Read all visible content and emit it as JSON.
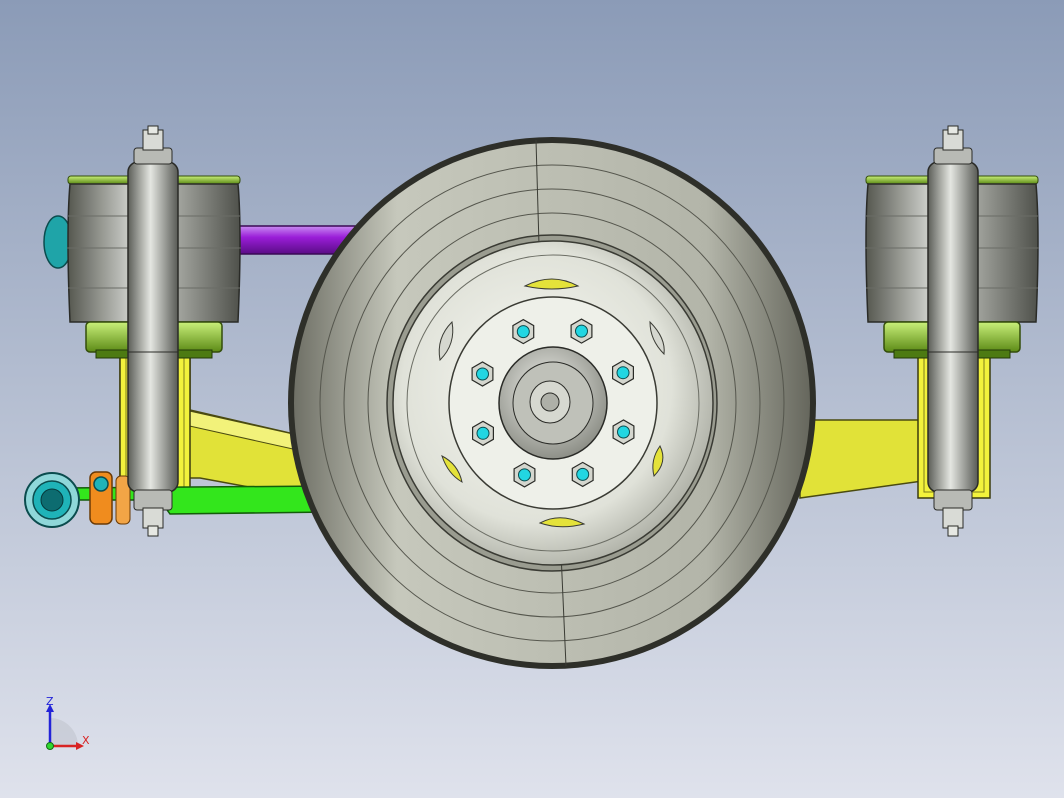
{
  "viewport": {
    "background_top": "#8b9bb7",
    "background_bottom": "#dfe2ec"
  },
  "colors": {
    "tire": "#86877a",
    "tire_dark": "#2e2f29",
    "rim": "#e6e8e0",
    "lug_nut": "#22d6e2",
    "air_spring": "#a5a7a2",
    "spring_plate": "#8fc62c",
    "frame_bracket": "#f2f23c",
    "trailing_arm": "#e1e238",
    "lower_link": "#33e61c",
    "purple_rod": "#9a1ed8",
    "bushing": "#1fb3b8",
    "orange_clamp": "#f08c1e",
    "shock_body": "#9fa19e"
  },
  "triad": {
    "z_label": "Z",
    "x_label": "X",
    "z_color": "#2323d8",
    "x_color": "#d82323"
  }
}
